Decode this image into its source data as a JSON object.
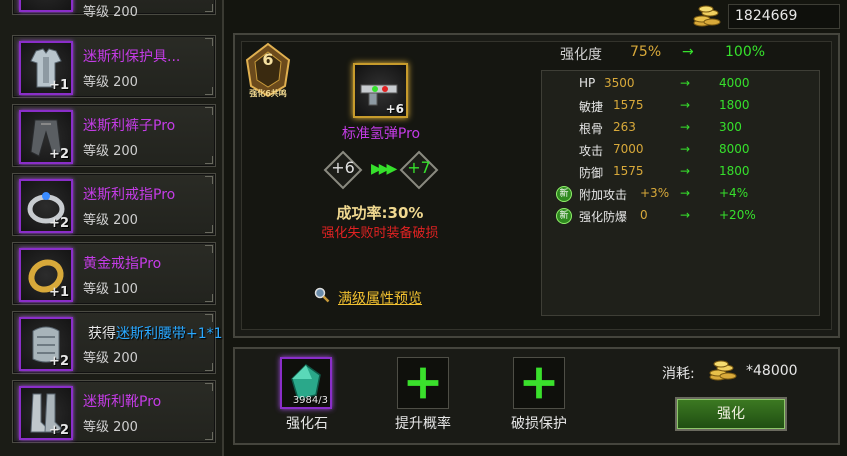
{
  "currency": {
    "gold": "1824669",
    "icon": "gold-coins-icon"
  },
  "inventory": {
    "partial_top_level": "等级 200",
    "items": [
      {
        "name": "迷斯利保护具...",
        "level": "等级 200",
        "plus": "+1",
        "icon": "armor-icon"
      },
      {
        "name": "迷斯利裤子Pro",
        "level": "等级 200",
        "plus": "+2",
        "icon": "pants-icon"
      },
      {
        "name": "迷斯利戒指Pro",
        "level": "等级 200",
        "plus": "+2",
        "icon": "ring-icon"
      },
      {
        "name": "黄金戒指Pro",
        "level": "等级 100",
        "plus": "+1",
        "icon": "gold-ring-icon"
      },
      {
        "name": "迷斯利腰带",
        "level": "等级 200",
        "plus": "+2",
        "icon": "belt-icon"
      },
      {
        "name": "迷斯利靴Pro",
        "level": "等级 200",
        "plus": "+2",
        "icon": "boots-icon"
      }
    ]
  },
  "toast": {
    "prefix": "获得",
    "item": "迷斯利腰带+1*1"
  },
  "enhance": {
    "badge_level": "6",
    "badge_text": "强化6共鸣",
    "equip_name": "标准氢弹Pro",
    "equip_plus": "+6",
    "current_level": "+6",
    "next_level": "+7",
    "arrows": "▶▶▶",
    "success_rate": "成功率:30%",
    "fail_note": "强化失败时装备破损",
    "preview_label": "满级属性预览",
    "degree_label": "强化度",
    "degree_from": "75%",
    "degree_arrow": "→",
    "degree_to": "100%"
  },
  "stats": [
    {
      "label": "HP",
      "from": "3500",
      "arrow": "→",
      "to": "4000",
      "is_new": false
    },
    {
      "label": "敏捷",
      "from": "1575",
      "arrow": "→",
      "to": "1800",
      "is_new": false
    },
    {
      "label": "根骨",
      "from": "263",
      "arrow": "→",
      "to": "300",
      "is_new": false
    },
    {
      "label": "攻击",
      "from": "7000",
      "arrow": "→",
      "to": "8000",
      "is_new": false
    },
    {
      "label": "防御",
      "from": "1575",
      "arrow": "→",
      "to": "1800",
      "is_new": false
    },
    {
      "label": "附加攻击",
      "from": "+3%",
      "arrow": "→",
      "to": "+4%",
      "is_new": true
    },
    {
      "label": "强化防爆",
      "from": "0",
      "arrow": "→",
      "to": "+20%",
      "is_new": true
    }
  ],
  "new_badge": "新",
  "bottom": {
    "stone_label": "强化石",
    "stone_count": "3984/3",
    "prob_label": "提升概率",
    "guard_label": "破损保护",
    "cost_label": "消耗:",
    "cost_value": "*48000",
    "enhance_button": "强化"
  },
  "colors": {
    "purple": "#c43ce6",
    "gold": "#d8a93a",
    "green": "#36e02c",
    "red": "#e02222"
  }
}
